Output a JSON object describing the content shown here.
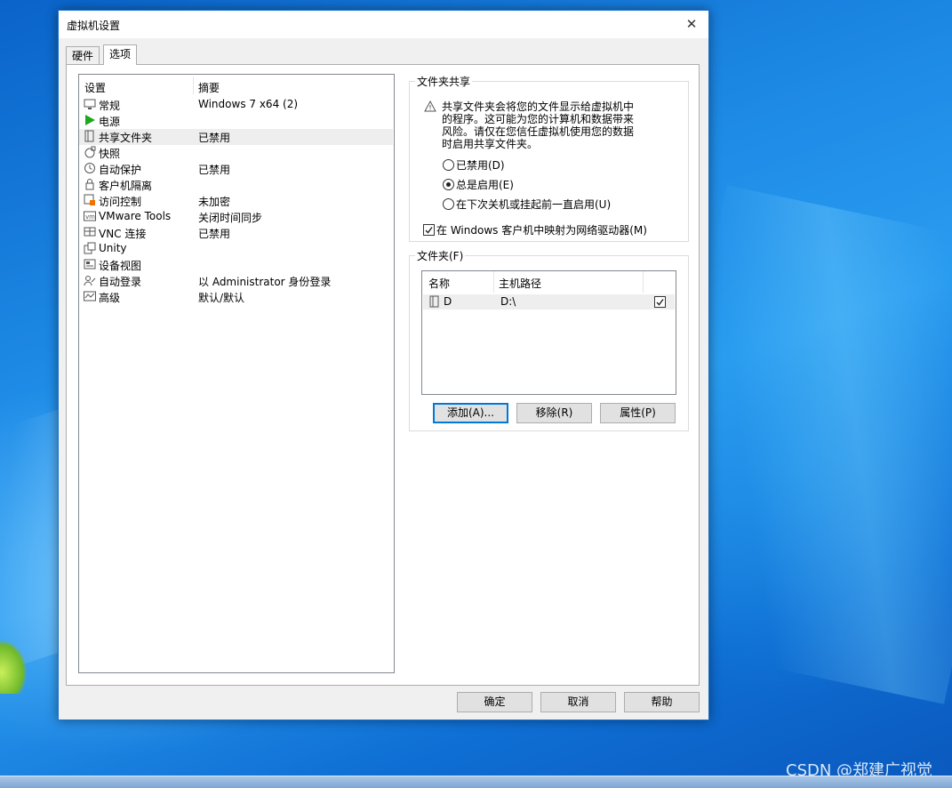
{
  "dialog": {
    "title": "虚拟机设置",
    "close": "✕"
  },
  "tabs": [
    {
      "label": "硬件"
    },
    {
      "label": "选项"
    }
  ],
  "settings": {
    "headers": {
      "name": "设置",
      "summary": "摘要"
    },
    "rows": [
      {
        "name": "常规",
        "value": "Windows 7 x64 (2)",
        "icon": "monitor-icon"
      },
      {
        "name": "电源",
        "value": "",
        "icon": "play-icon"
      },
      {
        "name": "共享文件夹",
        "value": "已禁用",
        "icon": "folder-share-icon"
      },
      {
        "name": "快照",
        "value": "",
        "icon": "snapshot-icon"
      },
      {
        "name": "自动保护",
        "value": "已禁用",
        "icon": "clock-icon"
      },
      {
        "name": "客户机隔离",
        "value": "",
        "icon": "lock-icon"
      },
      {
        "name": "访问控制",
        "value": "未加密",
        "icon": "access-control-icon"
      },
      {
        "name": "VMware Tools",
        "value": "关闭时间同步",
        "icon": "vm-icon"
      },
      {
        "name": "VNC 连接",
        "value": "已禁用",
        "icon": "vnc-icon"
      },
      {
        "name": "Unity",
        "value": "",
        "icon": "unity-icon"
      },
      {
        "name": "设备视图",
        "value": "",
        "icon": "device-view-icon"
      },
      {
        "name": "自动登录",
        "value": "以 Administrator 身份登录",
        "icon": "users-icon"
      },
      {
        "name": "高级",
        "value": "默认/默认",
        "icon": "advanced-icon"
      }
    ]
  },
  "folder_sharing": {
    "legend": "文件夹共享",
    "warning_lines": [
      "共享文件夹会将您的文件显示给虚拟机中",
      "的程序。这可能为您的计算机和数据带来",
      "风险。请仅在您信任虚拟机使用您的数据",
      "时启用共享文件夹。"
    ],
    "options": [
      {
        "label": "已禁用(D)",
        "checked": false
      },
      {
        "label": "总是启用(E)",
        "checked": true
      },
      {
        "label": "在下次关机或挂起前一直启用(U)",
        "checked": false
      }
    ],
    "map_drive": {
      "label": "在 Windows 客户机中映射为网络驱动器(M)",
      "checked": true
    }
  },
  "folders": {
    "legend": "文件夹(F)",
    "headers": {
      "name": "名称",
      "path": "主机路径"
    },
    "rows": [
      {
        "name": "D",
        "path": "D:\\",
        "enabled": true
      }
    ],
    "buttons": {
      "add": "添加(A)...",
      "remove": "移除(R)",
      "properties": "属性(P)"
    }
  },
  "footer": {
    "ok": "确定",
    "cancel": "取消",
    "help": "帮助"
  },
  "watermark": "CSDN @郑建广视觉",
  "colors": {
    "accent": "#0078d7",
    "play": "#1ea81e",
    "lock_badge": "#f07000"
  }
}
